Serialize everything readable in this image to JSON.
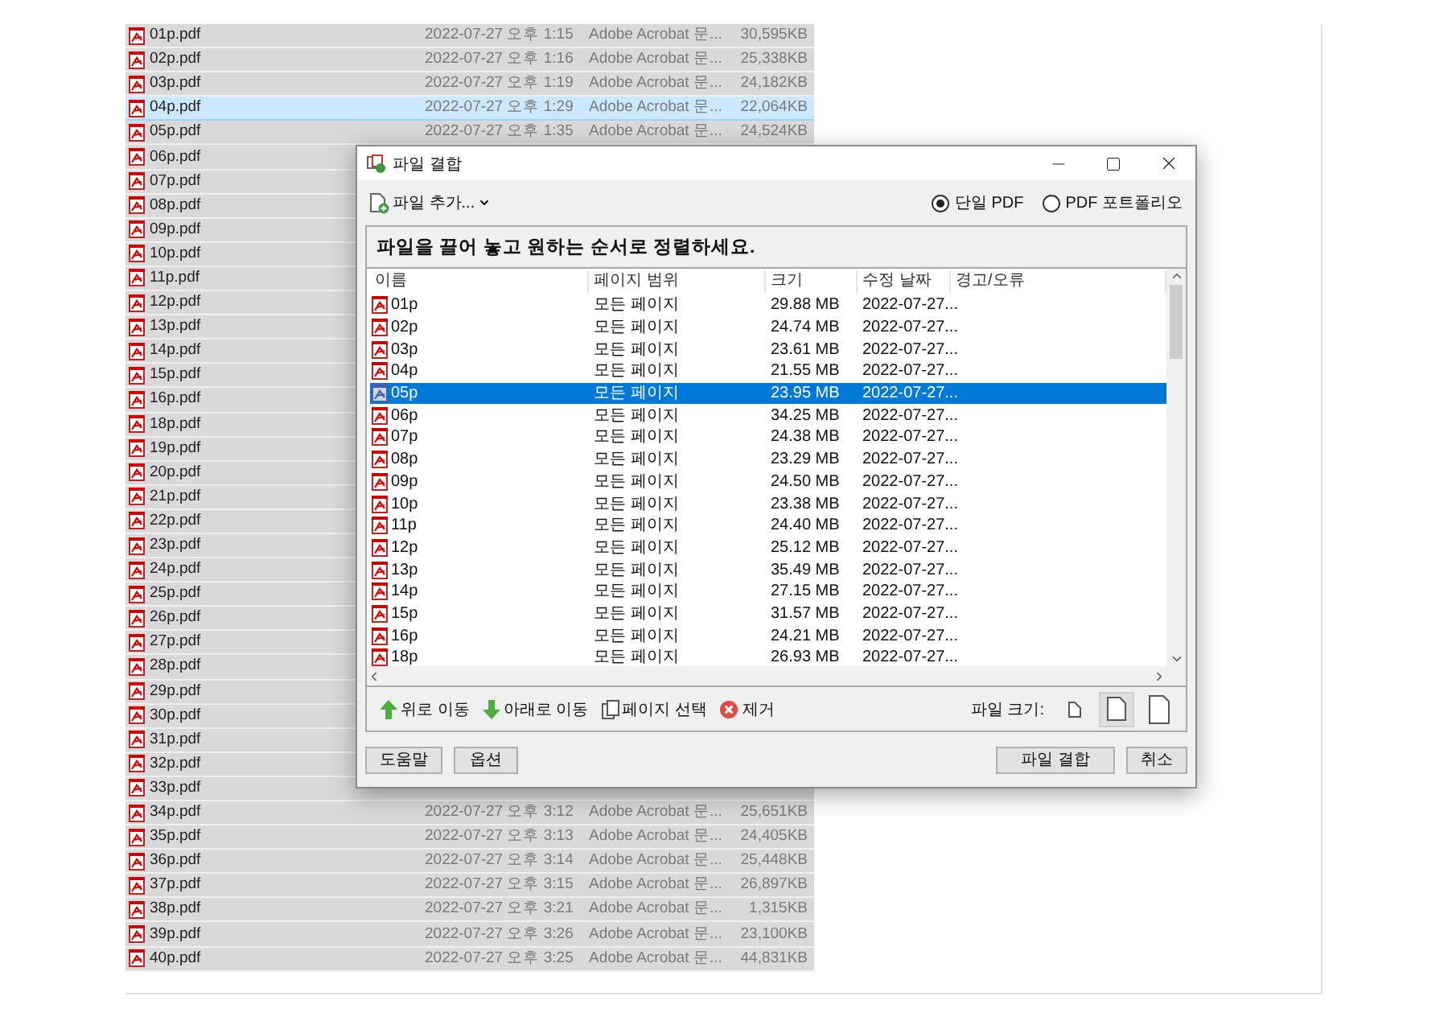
{
  "background_files": [
    {
      "name": "01p.pdf",
      "date": "2022-07-27 오후 1:15",
      "type": "Adobe Acrobat 문...",
      "size": "30,595KB",
      "selected": false
    },
    {
      "name": "02p.pdf",
      "date": "2022-07-27 오후 1:16",
      "type": "Adobe Acrobat 문...",
      "size": "25,338KB",
      "selected": false
    },
    {
      "name": "03p.pdf",
      "date": "2022-07-27 오후 1:19",
      "type": "Adobe Acrobat 문...",
      "size": "24,182KB",
      "selected": false
    },
    {
      "name": "04p.pdf",
      "date": "2022-07-27 오후 1:29",
      "type": "Adobe Acrobat 문...",
      "size": "22,064KB",
      "selected": true
    },
    {
      "name": "05p.pdf",
      "date": "2022-07-27 오후 1:35",
      "type": "Adobe Acrobat 문...",
      "size": "24,524KB",
      "selected": false
    },
    {
      "name": "06p.pdf",
      "selected": false
    },
    {
      "name": "07p.pdf",
      "selected": false
    },
    {
      "name": "08p.pdf",
      "selected": false
    },
    {
      "name": "09p.pdf",
      "selected": false
    },
    {
      "name": "10p.pdf",
      "selected": false
    },
    {
      "name": "11p.pdf",
      "selected": false
    },
    {
      "name": "12p.pdf",
      "selected": false
    },
    {
      "name": "13p.pdf",
      "selected": false
    },
    {
      "name": "14p.pdf",
      "selected": false
    },
    {
      "name": "15p.pdf",
      "selected": false
    },
    {
      "name": "16p.pdf",
      "selected": false
    },
    {
      "name": "18p.pdf",
      "selected": false
    },
    {
      "name": "19p.pdf",
      "selected": false
    },
    {
      "name": "20p.pdf",
      "selected": false
    },
    {
      "name": "21p.pdf",
      "selected": false
    },
    {
      "name": "22p.pdf",
      "selected": false
    },
    {
      "name": "23p.pdf",
      "selected": false
    },
    {
      "name": "24p.pdf",
      "selected": false
    },
    {
      "name": "25p.pdf",
      "selected": false
    },
    {
      "name": "26p.pdf",
      "selected": false
    },
    {
      "name": "27p.pdf",
      "selected": false
    },
    {
      "name": "28p.pdf",
      "selected": false
    },
    {
      "name": "29p.pdf",
      "selected": false
    },
    {
      "name": "30p.pdf",
      "selected": false
    },
    {
      "name": "31p.pdf",
      "selected": false
    },
    {
      "name": "32p.pdf",
      "selected": false
    },
    {
      "name": "33p.pdf",
      "selected": false
    },
    {
      "name": "34p.pdf",
      "date": "2022-07-27 오후 3:12",
      "type": "Adobe Acrobat 문...",
      "size": "25,651KB",
      "selected": false
    },
    {
      "name": "35p.pdf",
      "date": "2022-07-27 오후 3:13",
      "type": "Adobe Acrobat 문...",
      "size": "24,405KB",
      "selected": false
    },
    {
      "name": "36p.pdf",
      "date": "2022-07-27 오후 3:14",
      "type": "Adobe Acrobat 문...",
      "size": "25,448KB",
      "selected": false
    },
    {
      "name": "37p.pdf",
      "date": "2022-07-27 오후 3:15",
      "type": "Adobe Acrobat 문...",
      "size": "26,897KB",
      "selected": false
    },
    {
      "name": "38p.pdf",
      "date": "2022-07-27 오후 3:21",
      "type": "Adobe Acrobat 문...",
      "size": "1,315KB",
      "selected": false
    },
    {
      "name": "39p.pdf",
      "date": "2022-07-27 오후 3:26",
      "type": "Adobe Acrobat 문...",
      "size": "23,100KB",
      "selected": false
    },
    {
      "name": "40p.pdf",
      "date": "2022-07-27 오후 3:25",
      "type": "Adobe Acrobat 문...",
      "size": "44,831KB",
      "selected": false
    }
  ],
  "dialog": {
    "title": "파일 결합",
    "add_files": "파일 추가...",
    "output_options": [
      {
        "label": "단일 PDF",
        "selected": true
      },
      {
        "label": "PDF 포트폴리오",
        "selected": false
      }
    ],
    "instruction": "파일을 끌어 놓고 원하는 순서로 정렬하세요.",
    "columns": [
      "이름",
      "페이지 범위",
      "크기",
      "수정 날짜",
      "경고/오류"
    ],
    "files": [
      {
        "name": "01p",
        "page_range": "모든 페이지",
        "size": "29.88 MB",
        "date": "2022-07-27...",
        "selected": false
      },
      {
        "name": "02p",
        "page_range": "모든 페이지",
        "size": "24.74 MB",
        "date": "2022-07-27...",
        "selected": false
      },
      {
        "name": "03p",
        "page_range": "모든 페이지",
        "size": "23.61 MB",
        "date": "2022-07-27...",
        "selected": false
      },
      {
        "name": "04p",
        "page_range": "모든 페이지",
        "size": "21.55 MB",
        "date": "2022-07-27...",
        "selected": false
      },
      {
        "name": "05p",
        "page_range": "모든 페이지",
        "size": "23.95 MB",
        "date": "2022-07-27...",
        "selected": true
      },
      {
        "name": "06p",
        "page_range": "모든 페이지",
        "size": "34.25 MB",
        "date": "2022-07-27...",
        "selected": false
      },
      {
        "name": "07p",
        "page_range": "모든 페이지",
        "size": "24.38 MB",
        "date": "2022-07-27...",
        "selected": false
      },
      {
        "name": "08p",
        "page_range": "모든 페이지",
        "size": "23.29 MB",
        "date": "2022-07-27...",
        "selected": false
      },
      {
        "name": "09p",
        "page_range": "모든 페이지",
        "size": "24.50 MB",
        "date": "2022-07-27...",
        "selected": false
      },
      {
        "name": "10p",
        "page_range": "모든 페이지",
        "size": "23.38 MB",
        "date": "2022-07-27...",
        "selected": false
      },
      {
        "name": "11p",
        "page_range": "모든 페이지",
        "size": "24.40 MB",
        "date": "2022-07-27...",
        "selected": false
      },
      {
        "name": "12p",
        "page_range": "모든 페이지",
        "size": "25.12 MB",
        "date": "2022-07-27...",
        "selected": false
      },
      {
        "name": "13p",
        "page_range": "모든 페이지",
        "size": "35.49 MB",
        "date": "2022-07-27...",
        "selected": false
      },
      {
        "name": "14p",
        "page_range": "모든 페이지",
        "size": "27.15 MB",
        "date": "2022-07-27...",
        "selected": false
      },
      {
        "name": "15p",
        "page_range": "모든 페이지",
        "size": "31.57 MB",
        "date": "2022-07-27...",
        "selected": false
      },
      {
        "name": "16p",
        "page_range": "모든 페이지",
        "size": "24.21 MB",
        "date": "2022-07-27...",
        "selected": false
      },
      {
        "name": "18p",
        "page_range": "모든 페이지",
        "size": "26.93 MB",
        "date": "2022-07-27...",
        "selected": false
      }
    ],
    "actions": [
      {
        "kind": "move_up",
        "label": "위로 이동"
      },
      {
        "kind": "move_down",
        "label": "아래로 이동"
      },
      {
        "kind": "pages",
        "label": "페이지 선택"
      },
      {
        "kind": "remove",
        "label": "제거"
      }
    ],
    "file_size_label": "파일 크기:",
    "file_size_options": [
      {
        "kind": "small",
        "selected": false
      },
      {
        "kind": "medium",
        "selected": true
      },
      {
        "kind": "large",
        "selected": false
      }
    ],
    "buttons_left": [
      "도움말",
      "옵션"
    ],
    "buttons_right": [
      "파일 결합",
      "취소"
    ]
  }
}
